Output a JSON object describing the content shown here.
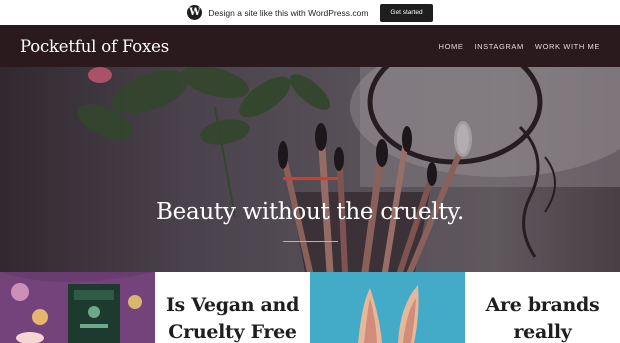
{
  "wp_bar": {
    "logo_letter": "W",
    "text": "Design a site like this with WordPress.com",
    "cta": "Get started"
  },
  "header": {
    "title": "Pocketful of Foxes",
    "nav": [
      "HOME",
      "INSTAGRAM",
      "WORK WITH ME"
    ]
  },
  "hero": {
    "tagline": "Beauty without the cruelty.",
    "accent": "#d63b2f"
  },
  "posts": [
    {
      "title": ""
    },
    {
      "title_line1": "Is Vegan and",
      "title_line2": "Cruelty Free"
    },
    {
      "title": ""
    },
    {
      "title_line1": "Are brands",
      "title_line2": "really"
    }
  ],
  "colors": {
    "header_bg": "#2a1a1e",
    "hero_accent": "#d63b2f",
    "tile_blue": "#3fa9c6",
    "tile_purple": "#6a3a6e"
  }
}
